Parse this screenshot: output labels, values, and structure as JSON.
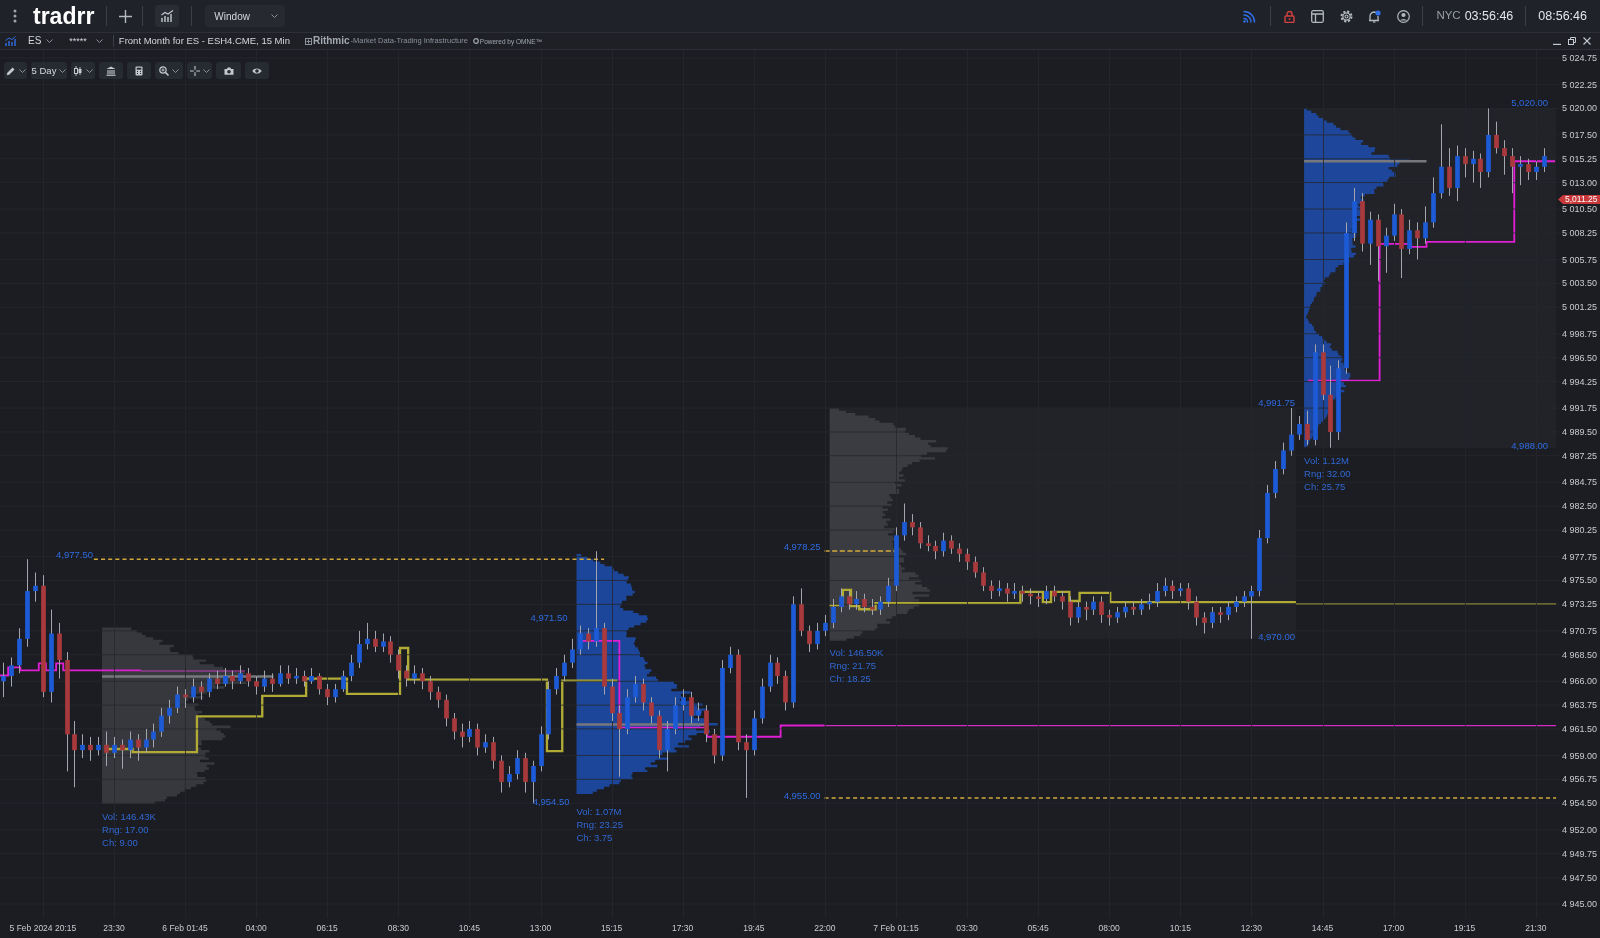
{
  "top_bar": {
    "logo": "tradrr",
    "menu": "Window",
    "world_clock": {
      "city": "NYC",
      "time": "03:56:46"
    },
    "local_time": "08:56:46"
  },
  "symbol_bar": {
    "symbol": "ES",
    "watchlist": "*****",
    "description": "Front Month for ES - ESH4.CME, 15 Min",
    "data_provider": {
      "name": "Rithmic",
      "tagline": "-Market Data-Trading Infrastructure",
      "powered_by": "Powered by OMNE™"
    }
  },
  "chart_toolbar": {
    "range": "5 Day"
  },
  "chart": {
    "level_labels": [
      "4,977.50",
      "4,971.50",
      "4,954.50",
      "4,978.25",
      "4,955.00",
      "4,991.75",
      "4,970.00",
      "5,020.00",
      "4,988.00"
    ],
    "session_stats": [
      {
        "volume": "Vol: 146.43K",
        "range": "Rng: 17.00",
        "change": "Ch: 9.00"
      },
      {
        "volume": "Vol: 1.07M",
        "range": "Rng: 23.25",
        "change": "Ch: 3.75"
      },
      {
        "volume": "Vol: 146.50K",
        "range": "Rng: 21.75",
        "change": "Ch: 18.25"
      },
      {
        "volume": "Vol: 1.12M",
        "range": "Rng: 32.00",
        "change": "Ch: 25.75"
      }
    ],
    "last_price": "5,011.25",
    "chart_data": {
      "type": "candlestick",
      "grid": true,
      "ylim": [
        4943.68,
        5025.5
      ],
      "categories": [
        null,
        null,
        null,
        null,
        null,
        "5 Feb 2024 20:15",
        null,
        null,
        null,
        null,
        null,
        null,
        null,
        null,
        "23:30",
        null,
        null,
        null,
        null,
        null,
        null,
        null,
        null,
        "6 Feb 01:45",
        null,
        null,
        null,
        null,
        null,
        null,
        null,
        null,
        "04:00",
        null,
        null,
        null,
        null,
        null,
        null,
        null,
        null,
        "06:15",
        null,
        null,
        null,
        null,
        null,
        null,
        null,
        null,
        "08:30",
        null,
        null,
        null,
        null,
        null,
        null,
        null,
        null,
        "10:45",
        null,
        null,
        null,
        null,
        null,
        null,
        null,
        null,
        "13:00",
        null,
        null,
        null,
        null,
        null,
        null,
        null,
        null,
        "15:15",
        null,
        null,
        null,
        null,
        null,
        null,
        null,
        null,
        "17:30",
        null,
        null,
        null,
        null,
        null,
        null,
        null,
        null,
        "19:45",
        null,
        null,
        null,
        null,
        null,
        null,
        null,
        null,
        "22:00",
        null,
        null,
        null,
        null,
        null,
        null,
        null,
        null,
        "7 Feb 01:15",
        null,
        null,
        null,
        null,
        null,
        null,
        null,
        null,
        "03:30",
        null,
        null,
        null,
        null,
        null,
        null,
        null,
        null,
        "05:45",
        null,
        null,
        null,
        null,
        null,
        null,
        null,
        null,
        "08:00",
        null,
        null,
        null,
        null,
        null,
        null,
        null,
        null,
        "10:15",
        null,
        null,
        null,
        null,
        null,
        null,
        null,
        null,
        "12:30",
        null,
        null,
        null,
        null,
        null,
        null,
        null,
        null,
        "14:45",
        null,
        null,
        null,
        null,
        null,
        null,
        null,
        null,
        "17:00",
        null,
        null,
        null,
        null,
        null,
        null,
        null,
        null,
        "19:15",
        null,
        null,
        null,
        null,
        null,
        null,
        null,
        null,
        "21:30",
        null
      ],
      "ohlc": [
        [
          4966,
          4967.75,
          4964.5,
          4966.5
        ],
        [
          4966.5,
          4968.25,
          4965.5,
          4967.5
        ],
        [
          4967.5,
          4971,
          4966.75,
          4970
        ],
        [
          4970,
          4977.5,
          4969.25,
          4974.5
        ],
        [
          4974.5,
          4976.25,
          4973.5,
          4975
        ],
        [
          4975,
          4976,
          4964.5,
          4965
        ],
        [
          4965,
          4972.75,
          4964,
          4970.5
        ],
        [
          4970.5,
          4971.5,
          4966.25,
          4968
        ],
        [
          4968,
          4968.75,
          4957.5,
          4961
        ],
        [
          4961,
          4962.25,
          4956,
          4959.5
        ],
        [
          4959.5,
          4961,
          4958.75,
          4960
        ],
        [
          4960,
          4960.75,
          4958.5,
          4959.5
        ],
        [
          4959.5,
          4960.75,
          4959,
          4960
        ],
        [
          4960,
          4961.25,
          4958,
          4959.25
        ],
        [
          4959.25,
          4960.75,
          4958.75,
          4960
        ],
        [
          4960,
          4960.5,
          4957.75,
          4959.5
        ],
        [
          4959.5,
          4961.25,
          4958.75,
          4960.5
        ],
        [
          4960.5,
          4961,
          4958.5,
          4959.75
        ],
        [
          4959.75,
          4961.5,
          4959.25,
          4960.5
        ],
        [
          4960.5,
          4962,
          4959.75,
          4961.25
        ],
        [
          4961.25,
          4963.5,
          4960.75,
          4962.75
        ],
        [
          4962.75,
          4964.25,
          4962,
          4963.5
        ],
        [
          4963.5,
          4965.5,
          4963,
          4964.75
        ],
        [
          4964.75,
          4965.25,
          4963.5,
          4964.5
        ],
        [
          4964.5,
          4966.25,
          4964,
          4965.5
        ],
        [
          4965.5,
          4966,
          4964.25,
          4965
        ],
        [
          4965,
          4966.75,
          4964.5,
          4966.25
        ],
        [
          4966.25,
          4967,
          4965.25,
          4965.75
        ],
        [
          4965.75,
          4967.25,
          4965.5,
          4966.5
        ],
        [
          4966.5,
          4967,
          4965.25,
          4966
        ],
        [
          4966,
          4967.5,
          4965.75,
          4966.75
        ],
        [
          4966.75,
          4967.25,
          4965.5,
          4966
        ],
        [
          4966,
          4966.5,
          4964.75,
          4965.5
        ],
        [
          4965.5,
          4967,
          4965,
          4966.25
        ],
        [
          4966.25,
          4966.75,
          4965,
          4965.75
        ],
        [
          4965.75,
          4967.5,
          4965.5,
          4966.75
        ],
        [
          4966.75,
          4967.5,
          4965.75,
          4966.25
        ],
        [
          4966.25,
          4967.25,
          4965.75,
          4966.5
        ],
        [
          4966.5,
          4967,
          4965.5,
          4966
        ],
        [
          4966,
          4967.25,
          4965.75,
          4966.5
        ],
        [
          4966.5,
          4966.75,
          4964.75,
          4965.25
        ],
        [
          4965.25,
          4965.75,
          4963.75,
          4964.5
        ],
        [
          4964.5,
          4965.75,
          4964,
          4965.25
        ],
        [
          4965.25,
          4967,
          4965,
          4966.5
        ],
        [
          4966.5,
          4968.5,
          4966,
          4967.75
        ],
        [
          4967.75,
          4970.75,
          4967.25,
          4969.5
        ],
        [
          4969.5,
          4971.5,
          4969,
          4970
        ],
        [
          4970,
          4970.75,
          4968.75,
          4969.25
        ],
        [
          4969.25,
          4970.5,
          4968.75,
          4969.75
        ],
        [
          4969.75,
          4970.25,
          4967.75,
          4968.5
        ],
        [
          4968.5,
          4969,
          4966.25,
          4967
        ],
        [
          4967,
          4967.5,
          4965.5,
          4966.25
        ],
        [
          4966.25,
          4967.5,
          4965.75,
          4966.75
        ],
        [
          4966.75,
          4967.25,
          4965.25,
          4966
        ],
        [
          4966,
          4966.5,
          4964.25,
          4965
        ],
        [
          4965,
          4965.5,
          4963.5,
          4964.25
        ],
        [
          4964.25,
          4964.75,
          4961.75,
          4962.5
        ],
        [
          4962.5,
          4963,
          4960.5,
          4961.25
        ],
        [
          4961.25,
          4962,
          4959.75,
          4960.75
        ],
        [
          4960.75,
          4962.25,
          4960.25,
          4961.5
        ],
        [
          4961.5,
          4962,
          4959,
          4959.75
        ],
        [
          4959.75,
          4961,
          4959.25,
          4960.25
        ],
        [
          4960.25,
          4960.75,
          4957.75,
          4958.5
        ],
        [
          4958.5,
          4959,
          4955.5,
          4956.5
        ],
        [
          4956.5,
          4958,
          4956,
          4957.25
        ],
        [
          4957.25,
          4959.5,
          4956.75,
          4958.75
        ],
        [
          4958.75,
          4959.25,
          4955.5,
          4956.5
        ],
        [
          4956.5,
          4958.5,
          4954.5,
          4958
        ],
        [
          4958,
          4961.75,
          4957.5,
          4961
        ],
        [
          4961,
          4966,
          4960.5,
          4965.25
        ],
        [
          4965.25,
          4967.25,
          4964.75,
          4966.5
        ],
        [
          4966.5,
          4968.5,
          4966,
          4967.75
        ],
        [
          4967.75,
          4970,
          4967.25,
          4969
        ],
        [
          4969,
          4971.25,
          4968.5,
          4970.5
        ],
        [
          4970.5,
          4971,
          4969,
          4969.75
        ],
        [
          4969.75,
          4978.25,
          4969.25,
          4971
        ],
        [
          4971,
          4971.5,
          4964.75,
          4965.5
        ],
        [
          4965.5,
          4966.25,
          4962.25,
          4963
        ],
        [
          4963,
          4963.75,
          4957,
          4961.5
        ],
        [
          4961.5,
          4965.25,
          4961,
          4964.5
        ],
        [
          4964.5,
          4966.5,
          4964,
          4965.75
        ],
        [
          4965.75,
          4966.25,
          4963.25,
          4964
        ],
        [
          4964,
          4964.5,
          4962,
          4962.75
        ],
        [
          4962.75,
          4963.25,
          4958.75,
          4959.5
        ],
        [
          4959.5,
          4962.25,
          4957.5,
          4961.5
        ],
        [
          4961.5,
          4964.5,
          4961,
          4963.75
        ],
        [
          4963.75,
          4965.25,
          4963.25,
          4964.5
        ],
        [
          4964.5,
          4965,
          4962,
          4962.75
        ],
        [
          4962.75,
          4964,
          4962.25,
          4963.25
        ],
        [
          4963.25,
          4963.75,
          4960.25,
          4961
        ],
        [
          4961,
          4961.5,
          4958.25,
          4959
        ],
        [
          4959,
          4968,
          4958.5,
          4967.25
        ],
        [
          4967.25,
          4969.25,
          4966.75,
          4968.5
        ],
        [
          4968.5,
          4969,
          4959.5,
          4960.25
        ],
        [
          4960.25,
          4961,
          4955,
          4959.5
        ],
        [
          4959.5,
          4963.25,
          4959,
          4962.5
        ],
        [
          4962.5,
          4966.25,
          4962,
          4965.5
        ],
        [
          4965.5,
          4968.5,
          4965,
          4967.75
        ],
        [
          4967.75,
          4968.25,
          4965.75,
          4966.5
        ],
        [
          4966.5,
          4967,
          4963.25,
          4964
        ],
        [
          4964,
          4974,
          4963.5,
          4973.25
        ],
        [
          4973.25,
          4974.75,
          4970.25,
          4970.75
        ],
        [
          4970.75,
          4971.25,
          4968.75,
          4969.5
        ],
        [
          4969.5,
          4971.5,
          4969,
          4970.75
        ],
        [
          4970.75,
          4972.25,
          4970.25,
          4971.5
        ],
        [
          4971.5,
          4973.75,
          4971,
          4973
        ],
        [
          4973,
          4974.75,
          4972.5,
          4974
        ],
        [
          4974,
          4974.5,
          4972.75,
          4973.25
        ],
        [
          4973.25,
          4974.5,
          4972.75,
          4973.75
        ],
        [
          4973.75,
          4974.25,
          4972.5,
          4973
        ],
        [
          4973,
          4973.75,
          4972.25,
          4972.75
        ],
        [
          4972.75,
          4974,
          4972.25,
          4973.5
        ],
        [
          4973.5,
          4975.75,
          4973,
          4975
        ],
        [
          4975,
          4980.5,
          4974.5,
          4979.75
        ],
        [
          4979.75,
          4982.75,
          4979.25,
          4981
        ],
        [
          4981,
          4981.75,
          4979.75,
          4980.5
        ],
        [
          4980.5,
          4981,
          4978.5,
          4979
        ],
        [
          4979,
          4979.75,
          4978.25,
          4978.75
        ],
        [
          4978.75,
          4979.25,
          4977.5,
          4978.25
        ],
        [
          4978.25,
          4980,
          4977.75,
          4979.25
        ],
        [
          4979.25,
          4979.75,
          4978,
          4978.5
        ],
        [
          4978.5,
          4979,
          4977.25,
          4978
        ],
        [
          4978,
          4978.5,
          4976.5,
          4977.25
        ],
        [
          4977.25,
          4977.75,
          4975.75,
          4976.25
        ],
        [
          4976.25,
          4976.75,
          4974.5,
          4975
        ],
        [
          4975,
          4975.5,
          4973.75,
          4974.5
        ],
        [
          4974.5,
          4975.5,
          4974,
          4974.75
        ],
        [
          4974.75,
          4975.25,
          4973.5,
          4974.25
        ],
        [
          4974.25,
          4975.25,
          4973.75,
          4974.5
        ],
        [
          4974.5,
          4975,
          4973.5,
          4974.25
        ],
        [
          4974.25,
          4974.75,
          4973.25,
          4974
        ],
        [
          4974,
          4974.5,
          4973,
          4973.75
        ],
        [
          4973.75,
          4975,
          4973.25,
          4974.5
        ],
        [
          4974.5,
          4975,
          4973.5,
          4974
        ],
        [
          4974,
          4974.5,
          4972.75,
          4973.5
        ],
        [
          4973.5,
          4974,
          4971.25,
          4972
        ],
        [
          4972,
          4973.5,
          4971.5,
          4973
        ],
        [
          4973,
          4973.5,
          4971.75,
          4972.75
        ],
        [
          4972.75,
          4974,
          4972.25,
          4973.5
        ],
        [
          4973.5,
          4974,
          4971.5,
          4972.25
        ],
        [
          4972.25,
          4972.75,
          4971.25,
          4972
        ],
        [
          4972,
          4973,
          4971.5,
          4972.5
        ],
        [
          4972.5,
          4973.5,
          4972,
          4973
        ],
        [
          4973,
          4973.5,
          4972.25,
          4972.75
        ],
        [
          4972.75,
          4973.75,
          4972.25,
          4973.25
        ],
        [
          4973.25,
          4974.25,
          4972.75,
          4973.5
        ],
        [
          4973.5,
          4975.25,
          4973,
          4974.5
        ],
        [
          4974.5,
          4975.75,
          4974,
          4975
        ],
        [
          4975,
          4975.5,
          4973.75,
          4974.5
        ],
        [
          4974.5,
          4975.25,
          4974,
          4974.75
        ],
        [
          4974.75,
          4975.25,
          4972.75,
          4973.5
        ],
        [
          4973.5,
          4974,
          4971.25,
          4972
        ],
        [
          4972,
          4972.5,
          4970.5,
          4971.5
        ],
        [
          4971.5,
          4973,
          4971,
          4972.5
        ],
        [
          4972.5,
          4973,
          4971.5,
          4972.25
        ],
        [
          4972.25,
          4973.5,
          4971.75,
          4973
        ],
        [
          4973,
          4974,
          4972.5,
          4973.5
        ],
        [
          4973.5,
          4974.5,
          4973,
          4974
        ],
        [
          4974,
          4975,
          4970,
          4974.5
        ],
        [
          4974.5,
          4980.25,
          4974,
          4979.5
        ],
        [
          4979.5,
          4984.5,
          4979,
          4983.75
        ],
        [
          4983.75,
          4986.75,
          4983.25,
          4986
        ],
        [
          4986,
          4988.5,
          4985.5,
          4987.75
        ],
        [
          4987.75,
          4991.75,
          4987.25,
          4989.25
        ],
        [
          4989.25,
          4991,
          4988.75,
          4990.25
        ],
        [
          4990.25,
          4991.5,
          4988.25,
          4988.75
        ],
        [
          4988.75,
          4997.75,
          4988.25,
          4997
        ],
        [
          4997,
          4997.75,
          4992.5,
          4993
        ],
        [
          4993,
          4995.75,
          4988,
          4989.5
        ],
        [
          4989.5,
          4996.25,
          4988.75,
          4995.5
        ],
        [
          4995.5,
          5009.25,
          4995,
          5008.25
        ],
        [
          5008.25,
          5012.5,
          5007.5,
          5011.25
        ],
        [
          5011.25,
          5012,
          5006.5,
          5007.25
        ],
        [
          5007.25,
          5010.25,
          5005.25,
          5009.5
        ],
        [
          5009.5,
          5010,
          5003.75,
          5007
        ],
        [
          5007,
          5008.75,
          5004.5,
          5008
        ],
        [
          5008,
          5011,
          5007.5,
          5010
        ],
        [
          5010,
          5010.5,
          5004,
          5006.75
        ],
        [
          5006.75,
          5009.5,
          5006.25,
          5008.5
        ],
        [
          5008.5,
          5009.25,
          5005.75,
          5007.75
        ],
        [
          5007.75,
          5010.75,
          5007.25,
          5009.25
        ],
        [
          5009.25,
          5013.5,
          5008.75,
          5012
        ],
        [
          5012,
          5018.5,
          5011.5,
          5014.5
        ],
        [
          5014.5,
          5016.25,
          5011.75,
          5012.5
        ],
        [
          5012.5,
          5016.5,
          5011.25,
          5015.5
        ],
        [
          5015.5,
          5016.25,
          5013.5,
          5014.75
        ],
        [
          5014.75,
          5016,
          5013,
          5015.25
        ],
        [
          5015.25,
          5015.75,
          5012.5,
          5014
        ],
        [
          5014,
          5020,
          5013.5,
          5017.5
        ],
        [
          5017.5,
          5018.75,
          5015.75,
          5016.25
        ],
        [
          5016.25,
          5017,
          5013.75,
          5015.5
        ],
        [
          5015.5,
          5016.25,
          5012,
          5014.5
        ],
        [
          5014.5,
          5015.5,
          5012.75,
          5014.75
        ],
        [
          5014.75,
          5015.25,
          5013.25,
          5014
        ],
        [
          5014,
          5015,
          5013.25,
          5014.5
        ],
        [
          5014.5,
          5016.25,
          5014,
          5015.5
        ]
      ],
      "yticks": [
        {
          "value": 5024.75,
          "label": "5 024.75"
        },
        {
          "value": 5022.25,
          "label": "5 022.25"
        },
        {
          "value": 5020,
          "label": "5 020.00"
        },
        {
          "value": 5017.5,
          "label": "5 017.50"
        },
        {
          "value": 5015.25,
          "label": "5 015.25"
        },
        {
          "value": 5013,
          "label": "5 013.00"
        },
        {
          "value": 5010.5,
          "label": "5 010.50"
        },
        {
          "value": 5008.25,
          "label": "5 008.25"
        },
        {
          "value": 5005.75,
          "label": "5 005.75"
        },
        {
          "value": 5003.5,
          "label": "5 003.50"
        },
        {
          "value": 5001.25,
          "label": "5 001.25"
        },
        {
          "value": 4998.75,
          "label": "4 998.75"
        },
        {
          "value": 4996.5,
          "label": "4 996.50"
        },
        {
          "value": 4994.25,
          "label": "4 994.25"
        },
        {
          "value": 4991.75,
          "label": "4 991.75"
        },
        {
          "value": 4989.5,
          "label": "4 989.50"
        },
        {
          "value": 4987.25,
          "label": "4 987.25"
        },
        {
          "value": 4984.75,
          "label": "4 984.75"
        },
        {
          "value": 4982.5,
          "label": "4 982.50"
        },
        {
          "value": 4980.25,
          "label": "4 980.25"
        },
        {
          "value": 4977.75,
          "label": "4 977.75"
        },
        {
          "value": 4975.5,
          "label": "4 975.50"
        },
        {
          "value": 4973.25,
          "label": "4 973.25"
        },
        {
          "value": 4970.75,
          "label": "4 970.75"
        },
        {
          "value": 4968.5,
          "label": "4 968.50"
        },
        {
          "value": 4966,
          "label": "4 966.00"
        },
        {
          "value": 4963.75,
          "label": "4 963.75"
        },
        {
          "value": 4961.5,
          "label": "4 961.50"
        },
        {
          "value": 4959,
          "label": "4 959.00"
        },
        {
          "value": 4956.75,
          "label": "4 956.75"
        },
        {
          "value": 4954.5,
          "label": "4 954.50"
        },
        {
          "value": 4952,
          "label": "4 952.00"
        },
        {
          "value": 4949.75,
          "label": "4 949.75"
        },
        {
          "value": 4947.5,
          "label": "4 947.50"
        },
        {
          "value": 4945,
          "label": "4 945.00"
        }
      ]
    }
  }
}
